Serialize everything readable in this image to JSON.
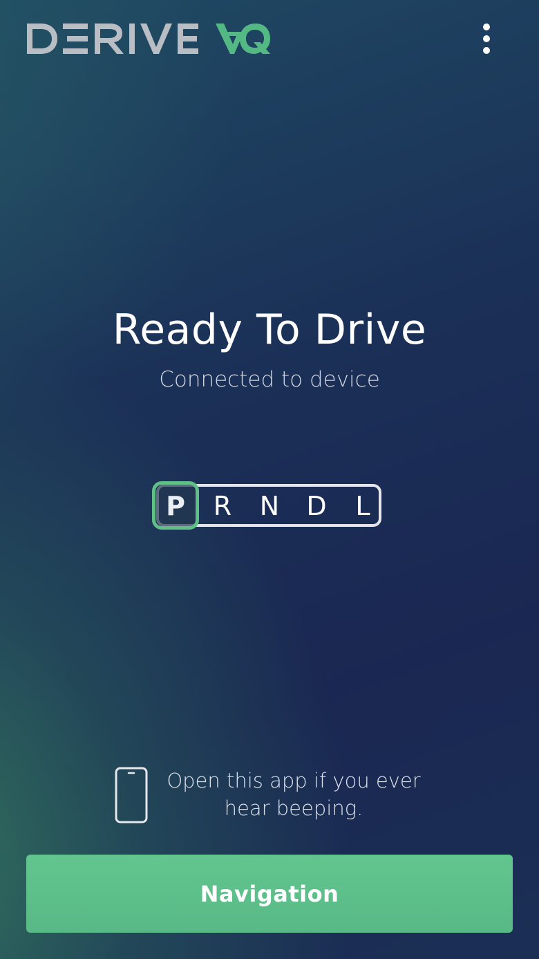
{
  "header": {
    "logo_text": "DERIVE VQ",
    "menu_icon": "more-vertical-icon"
  },
  "status": {
    "title": "Ready To Drive",
    "subtitle": "Connected to device"
  },
  "gear_selector": {
    "gears": [
      "P",
      "R",
      "N",
      "D",
      "L"
    ],
    "selected": "P"
  },
  "tip": {
    "icon": "phone-icon",
    "text_line1": "Open this app if you ever",
    "text_line2": "hear beeping."
  },
  "navigation_button": {
    "label": "Navigation"
  },
  "colors": {
    "accent": "#5fbf86",
    "button": "#5bbf88",
    "logo_gray": "#b9bdc4"
  }
}
